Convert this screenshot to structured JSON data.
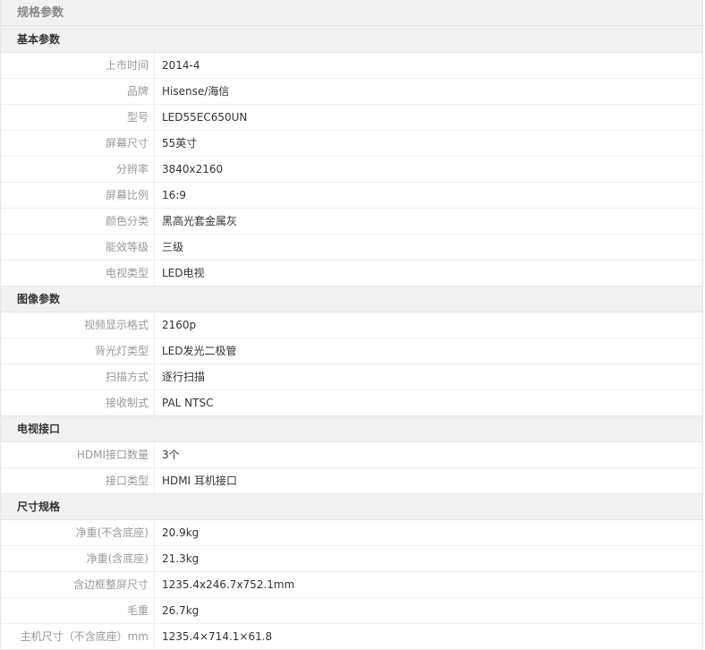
{
  "header": {
    "title": "规格参数"
  },
  "groups": [
    {
      "title": "基本参数",
      "rows": [
        {
          "label": "上市时间",
          "value": "2014-4"
        },
        {
          "label": "品牌",
          "value": "Hisense/海信"
        },
        {
          "label": "型号",
          "value": "LED55EC650UN"
        },
        {
          "label": "屏幕尺寸",
          "value": "55英寸"
        },
        {
          "label": "分辨率",
          "value": "3840x2160"
        },
        {
          "label": "屏幕比例",
          "value": "16:9"
        },
        {
          "label": "颜色分类",
          "value": "黑高光套金属灰"
        },
        {
          "label": "能效等级",
          "value": "三级"
        },
        {
          "label": "电视类型",
          "value": "LED电视"
        }
      ]
    },
    {
      "title": "图像参数",
      "rows": [
        {
          "label": "视频显示格式",
          "value": "2160p"
        },
        {
          "label": "背光灯类型",
          "value": "LED发光二极管"
        },
        {
          "label": "扫描方式",
          "value": "逐行扫描"
        },
        {
          "label": "接收制式",
          "value": "PAL NTSC"
        }
      ]
    },
    {
      "title": "电视接口",
      "rows": [
        {
          "label": "HDMI接口数量",
          "value": "3个"
        },
        {
          "label": "接口类型",
          "value": "HDMI 耳机接口"
        }
      ]
    },
    {
      "title": "尺寸规格",
      "rows": [
        {
          "label": "净重(不含底座)",
          "value": "20.9kg"
        },
        {
          "label": "净重(含底座)",
          "value": "21.3kg"
        },
        {
          "label": "含边框整屏尺寸",
          "value": "1235.4x246.7x752.1mm"
        },
        {
          "label": "毛重",
          "value": "26.7kg"
        },
        {
          "label": "主机尺寸（不含底座）mm",
          "value": "1235.4×714.1×61.8"
        }
      ]
    }
  ]
}
